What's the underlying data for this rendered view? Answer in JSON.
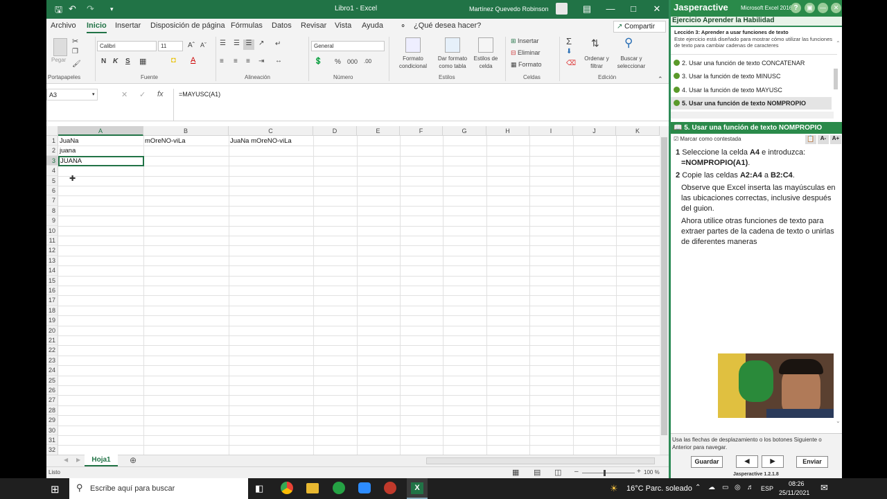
{
  "excel": {
    "title": "Libro1  -  Excel",
    "user": "Martínez Quevedo  Robinson",
    "menu_tabs": [
      "Archivo",
      "Inicio",
      "Insertar",
      "Disposición de página",
      "Fórmulas",
      "Datos",
      "Revisar",
      "Vista",
      "Ayuda"
    ],
    "tell_me": "¿Qué desea hacer?",
    "share": "Compartir",
    "ribbon": {
      "paste": "Pegar",
      "font_name": "Calibri",
      "font_size": "11",
      "bold": "N",
      "italic": "K",
      "underline": "S",
      "number_format": "General",
      "cond_format": "Formato condicional",
      "format_table": "Dar formato como tabla",
      "cell_styles": "Estilos de celda",
      "insert": "Insertar",
      "delete": "Eliminar",
      "format": "Formato",
      "sort_filter": "Ordenar y filtrar",
      "find_select": "Buscar y seleccionar",
      "groups": [
        "Portapapeles",
        "Fuente",
        "Alineación",
        "Número",
        "Estilos",
        "Celdas",
        "Edición"
      ]
    },
    "name_box": "A3",
    "formula": "=MAYUSC(A1)",
    "columns": [
      "A",
      "B",
      "C",
      "D",
      "E",
      "F",
      "G",
      "H",
      "I",
      "J",
      "K"
    ],
    "rows": [
      "1",
      "2",
      "3",
      "4",
      "5",
      "6",
      "7",
      "8",
      "9",
      "10",
      "11",
      "12",
      "13",
      "14",
      "15",
      "16",
      "17",
      "18",
      "19",
      "20",
      "21",
      "22",
      "23",
      "24",
      "25",
      "26",
      "27",
      "28",
      "29",
      "30",
      "31",
      "32"
    ],
    "cells": {
      "A1": "JuaNa",
      "B1": "mOreNO-viLa",
      "C1": "JuaNa mOreNO-viLa",
      "A2": "juana",
      "A3": "JUANA"
    },
    "sheet_tab": "Hoja1",
    "status": "Listo",
    "zoom": "100 %",
    "colors": {
      "accent": "#217346"
    }
  },
  "jasper": {
    "brand": "Jasperactive",
    "app": "Microsoft Excel 2016",
    "header": "Ejercicio Aprender la Habilidad",
    "lesson_title": "Lección 3: Aprender a usar funciones de texto",
    "lesson_desc": "Este ejercicio está diseñado para mostrar cómo utilizar las funciones de texto para cambiar cadenas de caracteres",
    "list": [
      "2. Usar una función de texto CONCATENAR",
      "3. Usar la función de texto MINUSC",
      "4. Usar la función de texto MAYUSC",
      "5. Usar una función de texto NOMPROPIO"
    ],
    "task_title": "5. Usar una función de texto NOMPROPIO",
    "mark_answered": "Marcar como contestada",
    "font_minus": "A-",
    "font_plus": "A+",
    "step1_num": "1",
    "step1_a": "Seleccione la celda ",
    "step1_b": "A4",
    "step1_c": " e introduzca:",
    "step1_formula": "=NOMPROPIO(A1)",
    "step2_num": "2",
    "step2_a": "Copie las celdas ",
    "step2_b": "A2:A4",
    "step2_c": " a ",
    "step2_d": "B2:C4",
    "step2_e": ".",
    "para1": "Observe que Excel inserta las mayúsculas en las ubicaciones correctas, inclusive después del guion.",
    "para2": "Ahora utilice otras funciones de texto para extraer partes de la cadena de texto o unirlas de diferentes maneras",
    "nav_hint": "Usa las flechas de desplazamiento o los botones Siguiente o Anterior para navegar.",
    "save": "Guardar",
    "submit": "Enviar",
    "version": "Jasperactive 1.2.1.8"
  },
  "taskbar": {
    "search": "Escribe aquí para buscar",
    "weather": "16°C  Parc. soleado",
    "lang": "ESP",
    "time": "08:26",
    "date": "25/11/2021"
  }
}
